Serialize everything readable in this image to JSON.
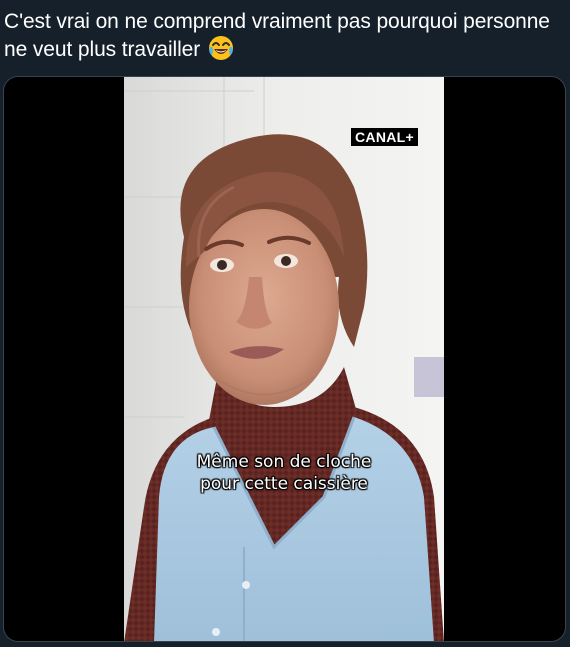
{
  "tweet": {
    "text": "C'est vrai on ne comprend vraiment pas pourquoi personne ne veut plus travailler",
    "emoji": "face-with-tears-of-joy"
  },
  "media": {
    "logo_text": "CANAL+",
    "caption_line1": "Même son de cloche",
    "caption_line2": "pour cette caissière"
  },
  "colors": {
    "background": "#15202b",
    "text": "#ffffff",
    "media_border": "#38444d"
  }
}
